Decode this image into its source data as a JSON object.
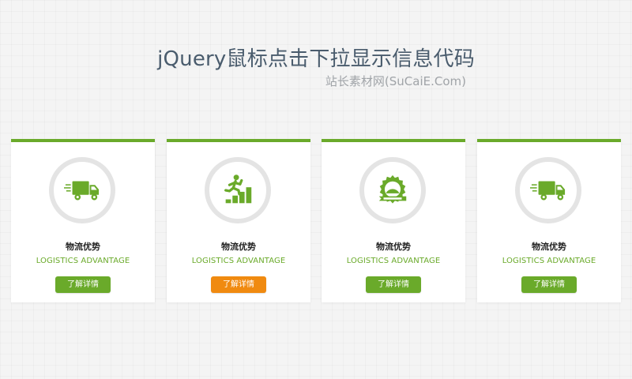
{
  "header": {
    "title": "jQuery鼠标点击下拉显示信息代码",
    "subtitle": "站长素材网(SuCaiE.Com)"
  },
  "colors": {
    "accent_green": "#6aaa2a",
    "active_orange": "#f08a10",
    "ring_gray": "#e4e4e4"
  },
  "cards": [
    {
      "icon": "delivery-truck-icon",
      "title": "物流优势",
      "subtitle": "LOGISTICS ADVANTAGE",
      "button_label": "了解详情",
      "active": false
    },
    {
      "icon": "climbing-stairs-icon",
      "title": "物流优势",
      "subtitle": "LOGISTICS ADVANTAGE",
      "button_label": "了解详情",
      "active": true
    },
    {
      "icon": "award-badge-icon",
      "title": "物流优势",
      "subtitle": "LOGISTICS ADVANTAGE",
      "button_label": "了解详情",
      "active": false
    },
    {
      "icon": "delivery-truck-icon",
      "title": "物流优势",
      "subtitle": "LOGISTICS ADVANTAGE",
      "button_label": "了解详情",
      "active": false
    }
  ]
}
